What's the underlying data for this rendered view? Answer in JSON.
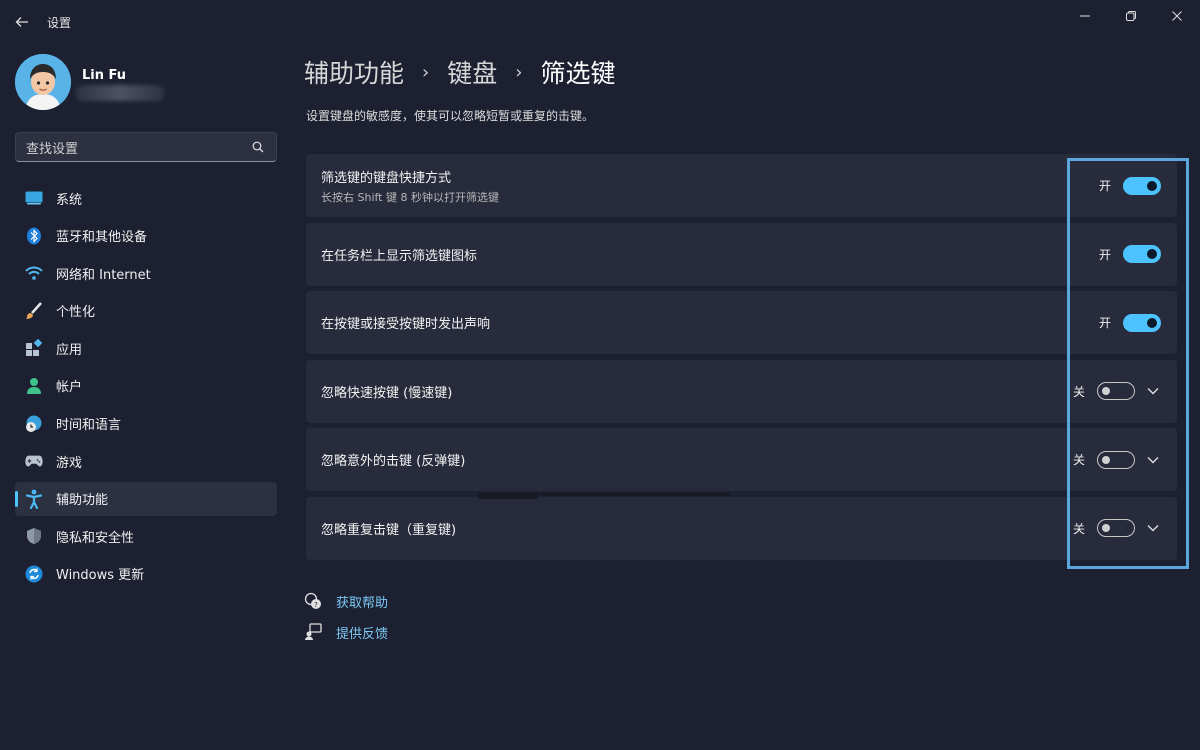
{
  "window": {
    "title": "设置",
    "controls": [
      "minimize",
      "maximize",
      "close"
    ]
  },
  "profile": {
    "name": "Lin Fu"
  },
  "search": {
    "placeholder": "查找设置"
  },
  "sidebar": {
    "items": [
      {
        "label": "系统",
        "icon": "system-icon"
      },
      {
        "label": "蓝牙和其他设备",
        "icon": "bluetooth-icon"
      },
      {
        "label": "网络和 Internet",
        "icon": "wifi-icon"
      },
      {
        "label": "个性化",
        "icon": "brush-icon"
      },
      {
        "label": "应用",
        "icon": "apps-icon"
      },
      {
        "label": "帐户",
        "icon": "account-icon"
      },
      {
        "label": "时间和语言",
        "icon": "globe-clock-icon"
      },
      {
        "label": "游戏",
        "icon": "gamepad-icon"
      },
      {
        "label": "辅助功能",
        "icon": "accessibility-icon",
        "selected": true
      },
      {
        "label": "隐私和安全性",
        "icon": "shield-icon"
      },
      {
        "label": "Windows 更新",
        "icon": "update-icon"
      }
    ]
  },
  "breadcrumb": {
    "level1": "辅助功能",
    "level2": "键盘",
    "current": "筛选键"
  },
  "page": {
    "description": "设置键盘的敏感度，使其可以忽略短暂或重复的击键。"
  },
  "settings": [
    {
      "title": "筛选键的键盘快捷方式",
      "subtitle": "长按右 Shift 键 8 秒钟以打开筛选键",
      "state": "开",
      "on": true,
      "expandable": false
    },
    {
      "title": "在任务栏上显示筛选键图标",
      "state": "开",
      "on": true,
      "expandable": false
    },
    {
      "title": "在按键或接受按键时发出声响",
      "state": "开",
      "on": true,
      "expandable": false
    },
    {
      "title": "忽略快速按键 (慢速键)",
      "state": "关",
      "on": false,
      "expandable": true
    },
    {
      "title": "忽略意外的击键 (反弹键)",
      "state": "关",
      "on": false,
      "expandable": true
    },
    {
      "title": "忽略重复击键（重复键)",
      "state": "关",
      "on": false,
      "expandable": true
    }
  ],
  "links": {
    "help": "获取帮助",
    "feedback": "提供反馈"
  },
  "colors": {
    "background": "#1c2030",
    "card": "#272b3b",
    "accent": "#4cc2ff",
    "link": "#7cc9f5",
    "highlight_box": "#5aa8da"
  }
}
